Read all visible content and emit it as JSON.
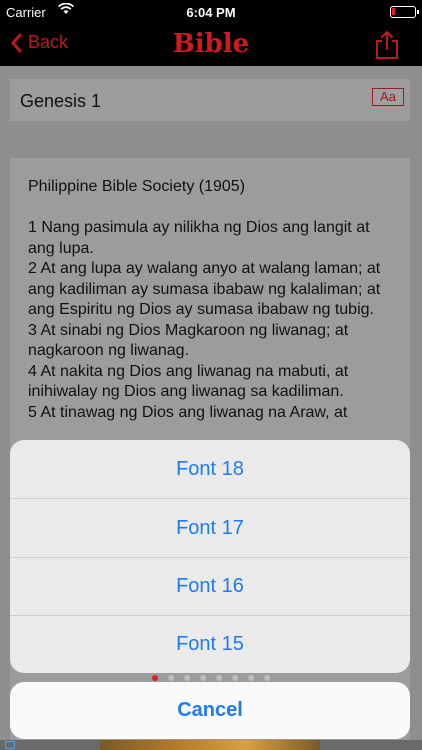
{
  "status_bar": {
    "carrier": "Carrier",
    "time": "6:04 PM"
  },
  "nav": {
    "back_label": "Back",
    "title": "Bible"
  },
  "chapter": {
    "label": "Genesis 1",
    "font_button": "Aa"
  },
  "reader": {
    "version": "Philippine Bible Society (1905)",
    "verses": [
      "1 Nang pasimula ay nilikha ng Dios ang langit at ang lupa.",
      "2 At ang lupa ay walang anyo at walang laman; at ang kadiliman ay sumasa ibabaw ng kalaliman; at ang Espiritu ng Dios ay sumasa ibabaw ng tubig.",
      "3 At sinabi ng Dios Magkaroon ng liwanag; at nagkaroon ng liwanag.",
      "4 At nakita ng Dios ang liwanag na mabuti, at inihiwalay ng Dios ang liwanag sa kadiliman.",
      "5 At tinawag ng Dios ang liwanag na Araw, at"
    ]
  },
  "action_sheet": {
    "options": [
      "Font 18",
      "Font 17",
      "Font 16",
      "Font 15"
    ],
    "cancel": "Cancel"
  },
  "colors": {
    "accent_red": "#d01a1f",
    "ios_blue": "#1d7cf2"
  }
}
